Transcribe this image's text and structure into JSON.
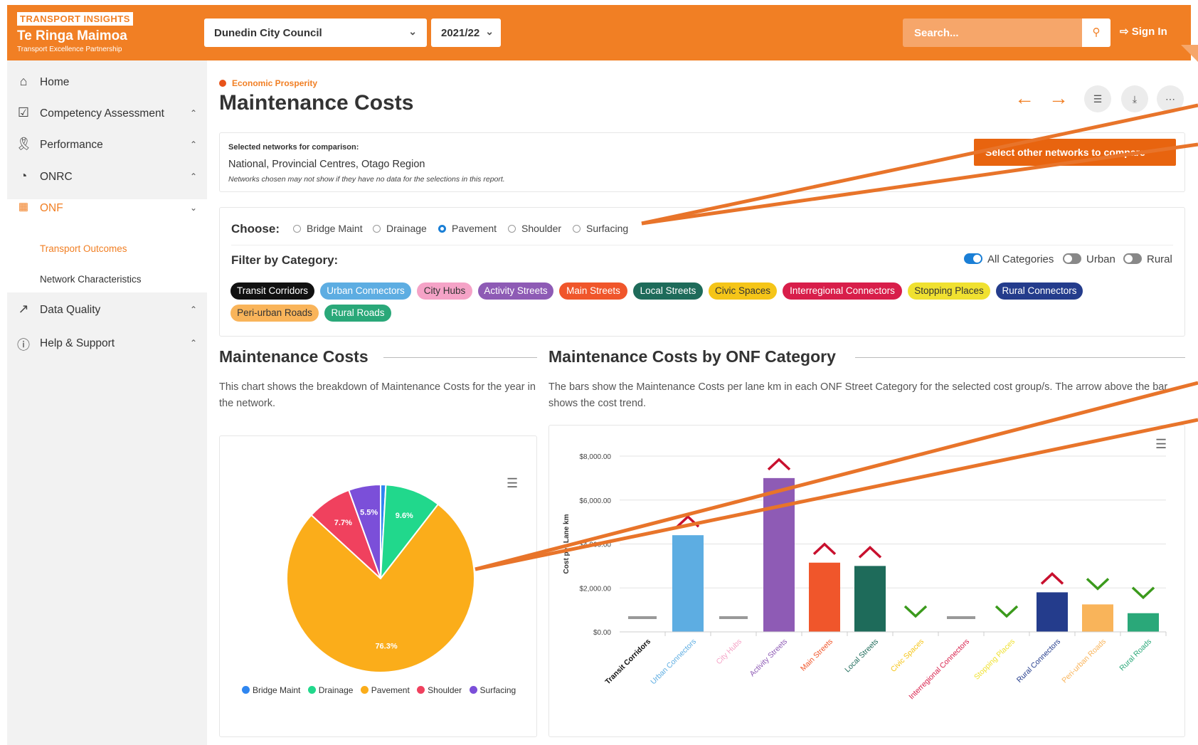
{
  "brand": {
    "tag": "TRANSPORT INSIGHTS",
    "name": "Te Ringa Maimoa",
    "subtitle": "Transport Excellence Partnership"
  },
  "header": {
    "council": "Dunedin City Council",
    "year": "2021/22",
    "search_placeholder": "Search...",
    "sign_in": "Sign In"
  },
  "sidebar": {
    "items": [
      {
        "label": "Home",
        "icon": "home-icon"
      },
      {
        "label": "Competency Assessment",
        "icon": "check-circle-icon"
      },
      {
        "label": "Performance",
        "icon": "award-icon"
      },
      {
        "label": "ONRC",
        "icon": "pie-icon"
      },
      {
        "label": "ONF",
        "icon": "grid-icon"
      },
      {
        "label": "Data Quality",
        "icon": "trend-icon"
      },
      {
        "label": "Help & Support",
        "icon": "help-icon"
      }
    ],
    "onf_subitems": [
      "Transport Outcomes",
      "Network Characteristics"
    ]
  },
  "page": {
    "eyebrow": "Economic Prosperity",
    "title": "Maintenance Costs"
  },
  "comparison": {
    "label": "Selected networks for comparison:",
    "value": "National, Provincial Centres, Otago Region",
    "note": "Networks chosen may not show if they have no data for the selections in this report.",
    "button": "Select other networks to compare"
  },
  "choose": {
    "label": "Choose:",
    "options": [
      "Bridge Maint",
      "Drainage",
      "Pavement",
      "Shoulder",
      "Surfacing"
    ],
    "selected": "Pavement"
  },
  "filter": {
    "label": "Filter by Category:",
    "toggles": [
      "All Categories",
      "Urban",
      "Rural"
    ],
    "categories": [
      {
        "label": "Transit Corridors",
        "color": "#111111"
      },
      {
        "label": "Urban Connectors",
        "color": "#5dade2"
      },
      {
        "label": "City Hubs",
        "color": "#f5a3c7"
      },
      {
        "label": "Activity Streets",
        "color": "#8e5bb5"
      },
      {
        "label": "Main Streets",
        "color": "#f0562b"
      },
      {
        "label": "Local Streets",
        "color": "#1e6b5a"
      },
      {
        "label": "Civic Spaces",
        "color": "#f5c518"
      },
      {
        "label": "Interregional Connectors",
        "color": "#d81e4a"
      },
      {
        "label": "Stopping Places",
        "color": "#f0e130"
      },
      {
        "label": "Rural Connectors",
        "color": "#243c8c"
      },
      {
        "label": "Peri-urban Roads",
        "color": "#f9b45a"
      },
      {
        "label": "Rural Roads",
        "color": "#2aa879"
      }
    ]
  },
  "sections": {
    "left_title": "Maintenance Costs",
    "left_desc": "This chart shows the breakdown of Maintenance Costs for the year in the network.",
    "right_title": "Maintenance Costs by ONF Category",
    "right_desc": "The bars show the Maintenance Costs per lane km in each ONF Street Category for the selected cost group/s. The arrow above the bar shows the cost trend."
  },
  "chart_data": [
    {
      "type": "pie",
      "labels": [
        "Bridge Maint",
        "Drainage",
        "Pavement",
        "Shoulder",
        "Surfacing"
      ],
      "values": [
        0.9,
        9.6,
        76.3,
        7.7,
        5.5
      ],
      "value_labels": [
        "",
        "9.6%",
        "76.3%",
        "7.7%",
        "5.5%"
      ],
      "colors": [
        "#2f86f0",
        "#21d88c",
        "#fbad1a",
        "#f0415e",
        "#7b4fd9"
      ],
      "legend": "bottom"
    },
    {
      "type": "bar",
      "ylabel": "Cost per Lane km",
      "ylim": [
        0,
        8000
      ],
      "yticks": [
        "$0.00",
        "$2,000.00",
        "$4,000.00",
        "$6,000.00",
        "$8,000.00"
      ],
      "categories": [
        "Transit Corridors",
        "Urban Connectors",
        "City Hubs",
        "Activity Streets",
        "Main Streets",
        "Local Streets",
        "Civic Spaces",
        "Interregional Connectors",
        "Stopping Places",
        "Rural Connectors",
        "Peri-urban Roads",
        "Rural Roads"
      ],
      "values": [
        0,
        4400,
        0,
        7000,
        3150,
        3000,
        0,
        0,
        0,
        1800,
        1250,
        850
      ],
      "trend": [
        "none",
        "up",
        "none",
        "up",
        "up",
        "up",
        "down",
        "none",
        "down",
        "up",
        "down",
        "down"
      ],
      "colors": [
        "#111111",
        "#5dade2",
        "#f5a3c7",
        "#8e5bb5",
        "#f0562b",
        "#1e6b5a",
        "#f5c518",
        "#d81e4a",
        "#f0e130",
        "#243c8c",
        "#f9b45a",
        "#2aa879"
      ],
      "grid": true
    }
  ]
}
